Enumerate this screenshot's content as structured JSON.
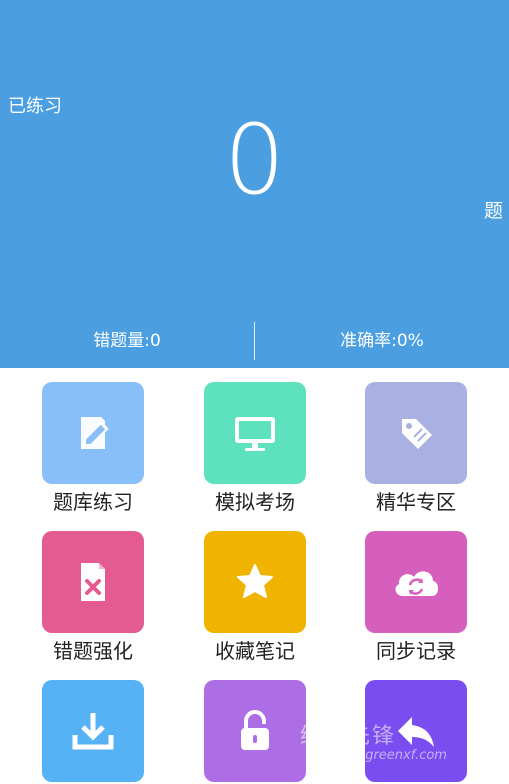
{
  "header": {
    "practiced_label": "已练习",
    "count": "0",
    "unit": "题",
    "wrong_count": "错题量:0",
    "accuracy": "准确率:0%"
  },
  "tiles": [
    {
      "label": "题库练习",
      "icon": "edit-note-icon",
      "color": "#89bff9"
    },
    {
      "label": "模拟考场",
      "icon": "monitor-icon",
      "color": "#5ee2bd"
    },
    {
      "label": "精华专区",
      "icon": "tag-icon",
      "color": "#a9b1e3"
    },
    {
      "label": "错题强化",
      "icon": "wrong-file-icon",
      "color": "#e45b91"
    },
    {
      "label": "收藏笔记",
      "icon": "star-icon",
      "color": "#f0b400"
    },
    {
      "label": "同步记录",
      "icon": "cloud-sync-icon",
      "color": "#d65fbe"
    },
    {
      "label": "",
      "icon": "download-icon",
      "color": "#55b2f5"
    },
    {
      "label": "",
      "icon": "lock-icon",
      "color": "#ad6de5"
    },
    {
      "label": "",
      "icon": "back-arrow-icon",
      "color": "#7a4df0"
    }
  ],
  "watermark": {
    "text": "绿色先锋",
    "url": "www.greenxf.com"
  }
}
